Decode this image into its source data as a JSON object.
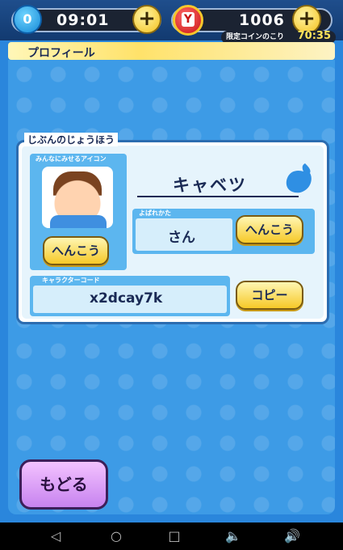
{
  "hud": {
    "stamina_badge": "0",
    "time": "09:01",
    "coins": "1006",
    "limited_label": "限定コインのこり",
    "limited_time": "70:35",
    "plus_glyph": "+"
  },
  "title": "プロフィール",
  "card": {
    "heading": "じぶんのじょうほう",
    "icon_label": "みんなにみせるアイコン",
    "icon_change_button": "へんこう",
    "name": "キャベツ",
    "honorific_label": "よばれかた",
    "honorific_value": "さん",
    "honorific_change_button": "へんこう",
    "code_label": "キャラクターコード",
    "code_value": "x2dcay7k",
    "copy_button": "コピー"
  },
  "back_button": "もどる",
  "navbar": {
    "back": "◁",
    "home": "○",
    "recent": "□",
    "vol_down": "🔈",
    "vol_up": "🔊"
  },
  "colors": {
    "background": "#2a86dc",
    "title_bar": "#ffe26a",
    "gold_button": "#f6c928",
    "back_button": "#c783ef",
    "card_border": "#2c6cb0"
  }
}
